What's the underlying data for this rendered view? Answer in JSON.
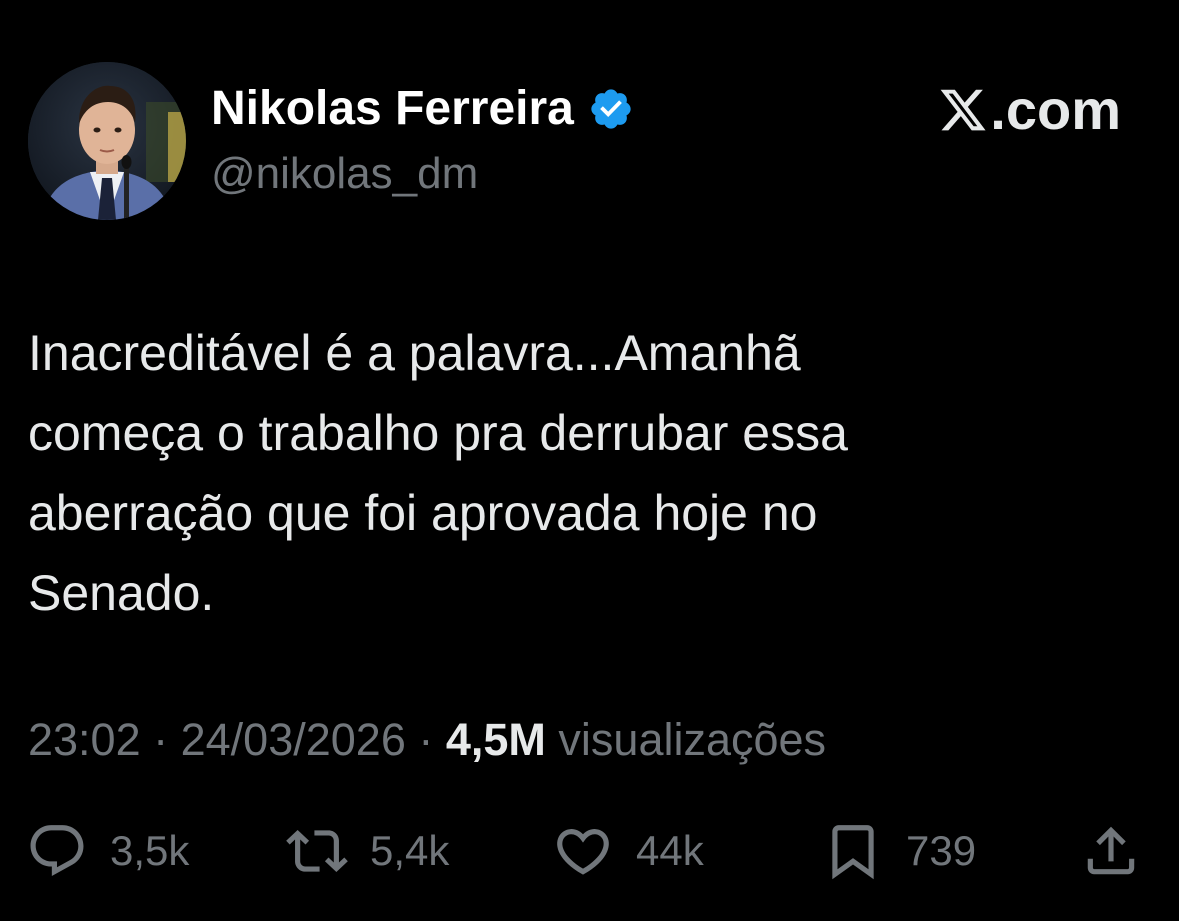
{
  "author": {
    "display_name": "Nikolas Ferreira",
    "handle": "@nikolas_dm",
    "verified": true,
    "avatar": "profile-photo"
  },
  "brand": {
    "suffix": ".com",
    "icon": "x-logo-icon"
  },
  "tweet": {
    "text_lines": [
      "Inacreditável é a palavra...Amanhã",
      "começa o trabalho pra derrubar essa",
      "aberração que foi aprovada hoje no",
      "Senado."
    ]
  },
  "meta": {
    "time": "23:02",
    "separator": " · ",
    "date": "24/03/2026",
    "views_count": "4,5M",
    "views_label": "visualizações"
  },
  "actions": {
    "reply": {
      "icon": "reply-icon",
      "count": "3,5k"
    },
    "repost": {
      "icon": "repost-icon",
      "count": "5,4k"
    },
    "like": {
      "icon": "heart-icon",
      "count": "44k"
    },
    "bookmark": {
      "icon": "bookmark-icon",
      "count": "739"
    },
    "share": {
      "icon": "share-icon"
    }
  },
  "colors": {
    "background": "#000000",
    "text_primary": "#e7e9ea",
    "text_secondary": "#71767b",
    "verified_badge": "#1d9bf0"
  }
}
